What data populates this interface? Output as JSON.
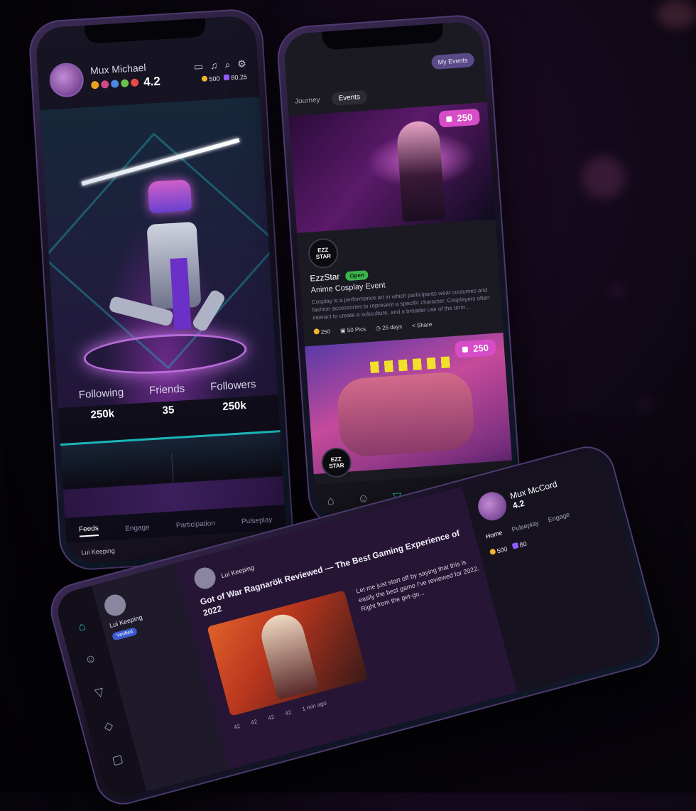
{
  "phone_profile": {
    "user_name": "Mux Michael",
    "rating": "4.2",
    "balance_coins": "500",
    "balance_gems": "80.25",
    "stats": [
      {
        "label": "Following",
        "value": "250k"
      },
      {
        "label": "Friends",
        "value": "35"
      },
      {
        "label": "Followers",
        "value": "250k"
      }
    ],
    "tabs": [
      "Feeds",
      "Engage",
      "Participation",
      "Pulseplay"
    ],
    "footer_name": "Lui Keeping",
    "colors": {
      "accent": "#1bb6b8",
      "brand": "#b86bd8"
    }
  },
  "phone_events": {
    "my_events_label": "My Events",
    "tabs": [
      "Journey",
      "Events"
    ],
    "card1": {
      "price": "250",
      "host": "EzzStar",
      "status": "Open",
      "title": "Anime Cosplay Event",
      "desc": "Cosplay is a performance art in which participants wear costumes and fashion accessories to represent a specific character. Cosplayers often interact to create a subculture, and a broader use of the term...",
      "coins": "250",
      "pics": "50 Pics",
      "days": "25 days",
      "share": "Share"
    },
    "card2": {
      "price": "250"
    },
    "logo_text": "EZZ STAR",
    "nav_icons": [
      "home-icon",
      "friends-icon",
      "play-icon",
      "cube-icon",
      "store-icon",
      "tv-icon"
    ]
  },
  "phone_feed": {
    "rail_icons": [
      "home-icon",
      "friends-icon",
      "play-icon",
      "cube-icon",
      "store-icon"
    ],
    "post_author": "Lui Keeping",
    "post_tag": "Verified",
    "feed_author": "Lui Keeping",
    "feed_title": "Got of War Ragnarök Reviewed — The Best Gaming Experience of 2022",
    "feed_text": "Let me just start off by saying that this is easily the best game I've reviewed for 2022. Right from the get-go...",
    "feed_stats": [
      "42",
      "42",
      "42",
      "42",
      "1 min ago"
    ],
    "side_name": "Mux McCord",
    "side_rating": "4.2",
    "side_tabs": [
      "Home",
      "Pulseplay",
      "Engage"
    ],
    "side_coins": "500",
    "side_gems": "80"
  }
}
